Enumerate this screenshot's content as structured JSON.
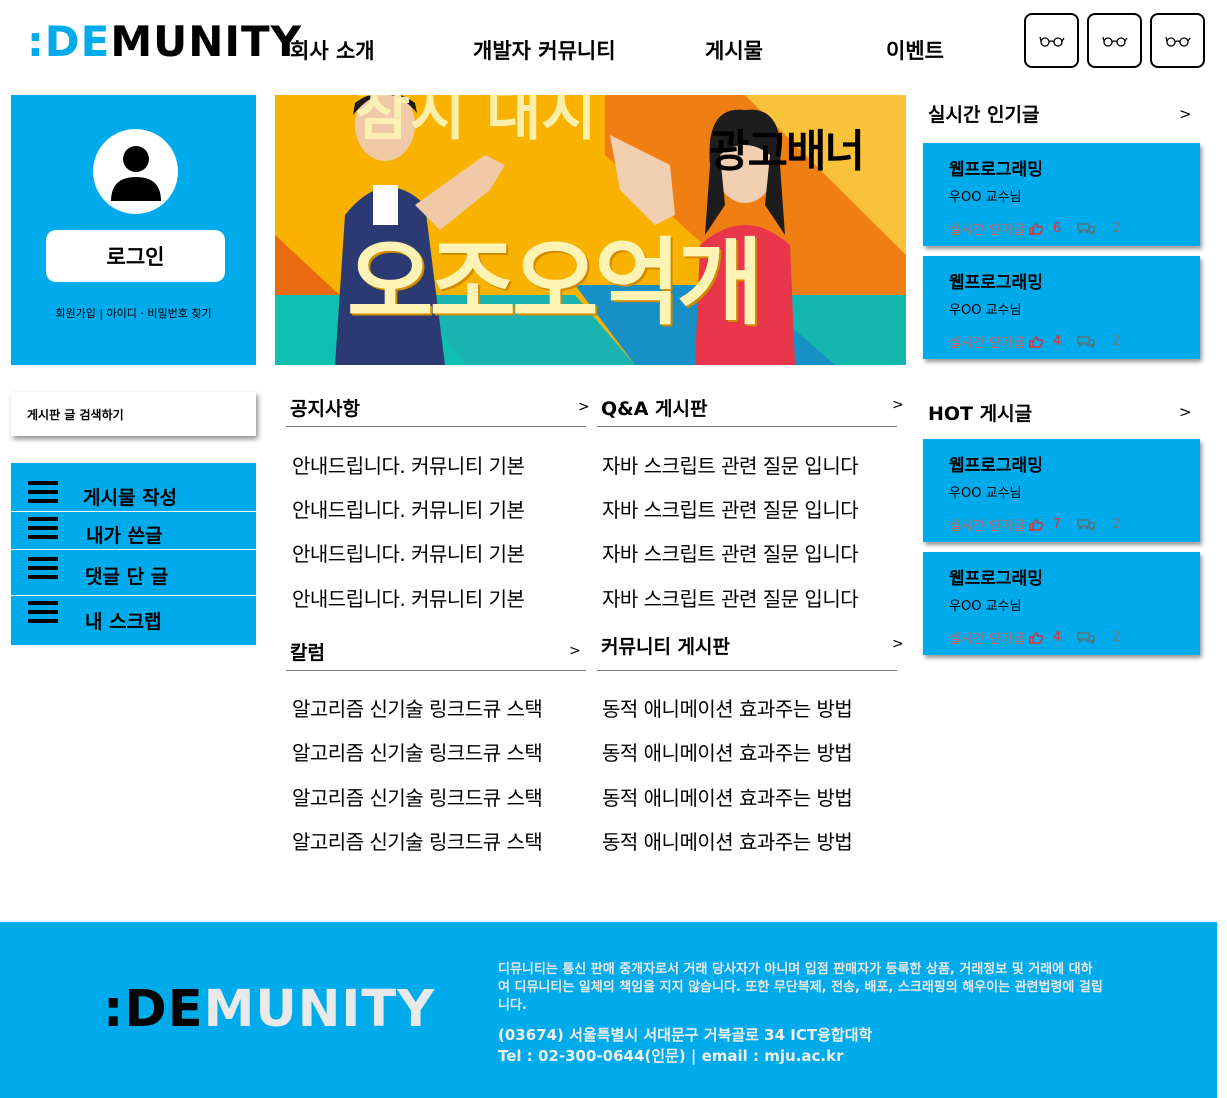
{
  "header": {
    "logo_accent": ":DE",
    "logo_rest": "MUNITY",
    "nav": [
      "회사 소개",
      "개발자 커뮤니티",
      "게시물",
      "이벤트"
    ],
    "icon_buttons": [
      "glasses-icon",
      "glasses-icon",
      "glasses-icon"
    ]
  },
  "login": {
    "button_label": "로그인",
    "links": "회원가입 | 아이디 · 비밀번호 찾기"
  },
  "search": {
    "label": "게시판 글 검색하기"
  },
  "menu": {
    "items": [
      "게시물 작성",
      "내가 쓴글",
      "댓글 단 글",
      "내 스크랩"
    ]
  },
  "banner": {
    "label": "광고배너",
    "big_text": "오조오억개",
    "top_text": "참시 대시"
  },
  "boards": {
    "notice": {
      "title": "공지사항",
      "more": ">",
      "posts": [
        "안내드립니다. 커뮤니티 기본",
        "안내드립니다. 커뮤니티 기본",
        "안내드립니다. 커뮤니티 기본",
        "안내드립니다. 커뮤니티 기본"
      ]
    },
    "qna": {
      "title": "Q&A 게시판",
      "more": ">",
      "posts": [
        "자바 스크립트 관련 질문 입니다",
        "자바 스크립트 관련 질문 입니다",
        "자바 스크립트 관련 질문 입니다",
        "자바 스크립트 관련 질문 입니다"
      ]
    },
    "column": {
      "title": "칼럼",
      "more": ">",
      "posts": [
        "알고리즘 신기술 링크드큐 스택",
        "알고리즘 신기술 링크드큐 스택",
        "알고리즘 신기술 링크드큐 스택",
        "알고리즘 신기술 링크드큐 스택"
      ]
    },
    "community": {
      "title": "커뮤니티 게시판",
      "more": ">",
      "posts": [
        "동적  애니메이션 효과주는 방법",
        "동적  애니메이션 효과주는 방법",
        "동적  애니메이션 효과주는 방법",
        "동적  애니메이션 효과주는 방법"
      ]
    }
  },
  "realtime": {
    "title": "실시간 인기글",
    "more": ">",
    "cards": [
      {
        "title": "웹프로그래밍",
        "author": "우OO 교수님",
        "tag": "실시간 인기글",
        "likes": "6",
        "comments": "2"
      },
      {
        "title": "웹프로그래밍",
        "author": "우OO 교수님",
        "tag": "실시간 인기글",
        "likes": "4",
        "comments": "2"
      }
    ]
  },
  "hot": {
    "title": "HOT 게시글",
    "more": ">",
    "cards": [
      {
        "title": "웹프로그래밍",
        "author": "우OO 교수님",
        "tag": "실시간 인기글",
        "likes": "7",
        "comments": "2"
      },
      {
        "title": "웹프로그래밍",
        "author": "우OO 교수님",
        "tag": "실시간 인기글",
        "likes": "4",
        "comments": "2"
      }
    ]
  },
  "footer": {
    "logo_accent": ":DE",
    "logo_rest": "MUNITY",
    "disclaimer": "디뮤니티는 통신 판매 중개자로서 거래 당사자가 아니며 입점 판매자가 등록한 상품, 거래정보 및 거래에 대하여 디뮤니티는 일체의 책임을 지지 않습니다. 또한 무단복제, 전송, 배포, 스크래핑의 해우이는 관련법령에 걸립니다.",
    "address": "(03674) 서울특별시 서대문구 거북골로 34 ICT융합대학",
    "contact": "Tel : 02-300-0644(인문) | email : mju.ac.kr"
  },
  "colors": {
    "accent": "#00abec",
    "like": "#ee2a2a"
  }
}
